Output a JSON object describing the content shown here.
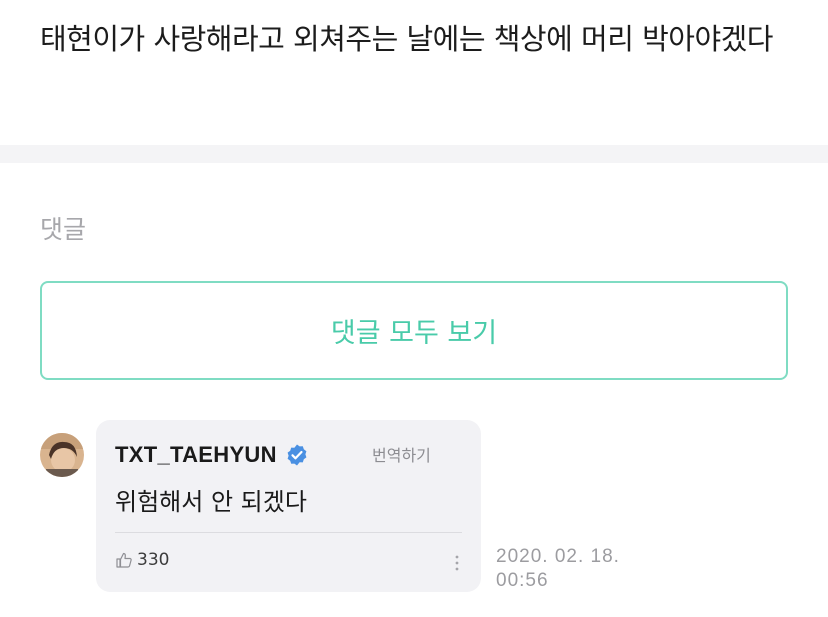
{
  "post": {
    "text": "태현이가 사랑해라고 외쳐주는 날에는 책상에 머리 박아야겠다"
  },
  "comments_section": {
    "heading": "댓글",
    "view_all_label": "댓글 모두 보기"
  },
  "comment": {
    "author": "TXT_TAEHYUN",
    "verified": true,
    "translate_label": "번역하기",
    "text": "위험해서 안 되겠다",
    "likes": "330",
    "timestamp": "2020. 02. 18. 00:56"
  },
  "colors": {
    "accent": "#49cba9",
    "accent_border": "#7fdcc3",
    "verified_badge": "#4a90e2",
    "card_background": "#f2f2f5"
  },
  "icons": {
    "verified": "verified-badge-icon",
    "like": "thumbs-up-icon",
    "more": "more-vertical-icon"
  }
}
